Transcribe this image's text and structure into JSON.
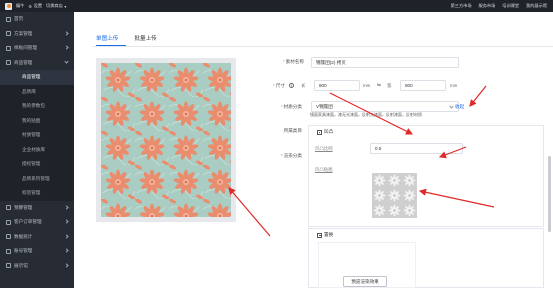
{
  "topbar": {
    "brand": "编牛",
    "settings": "设置",
    "switch_shop": "切换商店",
    "links": [
      "第三方市场",
      "服务市场",
      "培训课堂",
      "我的展示馆"
    ]
  },
  "sidebar": {
    "items": [
      {
        "label": "首页",
        "icon": "home-icon"
      },
      {
        "label": "方案管理",
        "icon": "folder-icon"
      },
      {
        "label": "样板间管理",
        "icon": "room-icon"
      },
      {
        "label": "商品管理",
        "icon": "goods-icon",
        "open": true
      }
    ],
    "sub_items": [
      {
        "label": "商品管理",
        "active": true
      },
      {
        "label": "品牌库"
      },
      {
        "label": "我的参数包"
      },
      {
        "label": "我的贴图"
      },
      {
        "label": "材质管理"
      },
      {
        "label": "企业材质库"
      },
      {
        "label": "授权管理"
      },
      {
        "label": "品牌系列管理"
      },
      {
        "label": "标签管理"
      }
    ],
    "bottom_items": [
      {
        "label": "预算管理",
        "icon": "budget-icon"
      },
      {
        "label": "客户订单管理",
        "icon": "order-icon"
      },
      {
        "label": "数据统计",
        "icon": "chart-icon"
      },
      {
        "label": "账号管理",
        "icon": "account-icon"
      },
      {
        "label": "展示馆",
        "icon": "gallery-icon"
      }
    ]
  },
  "tabs": [
    {
      "label": "单图上传",
      "active": true
    },
    {
      "label": "批量上传",
      "active": false
    }
  ],
  "form": {
    "name_label": "素材名称",
    "name_value": "锦簇团(2) 拷贝",
    "size_label": "尺寸",
    "length_label": "长",
    "length_value": "800",
    "width_label": "宽",
    "width_value": "800",
    "unit": "mm",
    "category_label": "材质分类",
    "category_value": "V锦簇团",
    "collapse_link": "收起",
    "tags_text": "镜面家具漆面，漆无光漆面，反射光漆面，反射漆面，反射材质",
    "group_label": "所属类目",
    "render_label": "渲染分类"
  },
  "bump_panel": {
    "title": "凹凸",
    "ratio_label": "凹凸比例",
    "ratio_value": "0.5",
    "map_label": "凹凸贴图"
  },
  "overlay_panel": {
    "title": "置换"
  },
  "preview_button": "预览渲染效果",
  "colors": {
    "accent": "#1a6ee8",
    "annotation": "#e02a2a",
    "sidebar_bg": "#272c34",
    "topbar_bg": "#1f2329"
  }
}
